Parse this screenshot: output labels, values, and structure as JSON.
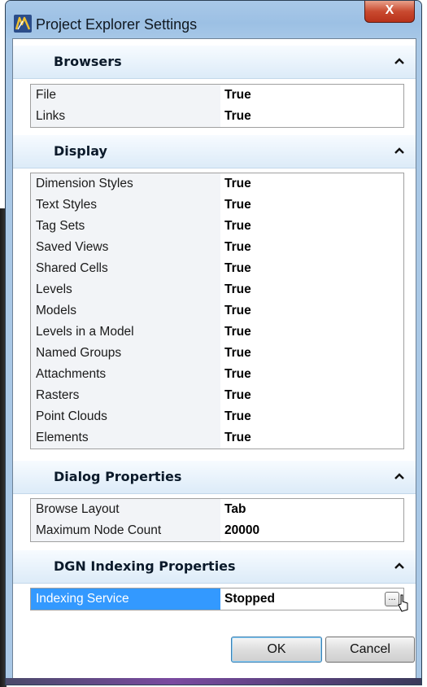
{
  "window": {
    "title": "Project Explorer Settings",
    "close_label": "X"
  },
  "sections": [
    {
      "header": "Browsers",
      "rows": [
        {
          "name": "File",
          "value": "True"
        },
        {
          "name": "Links",
          "value": "True"
        }
      ]
    },
    {
      "header": "Display",
      "rows": [
        {
          "name": "Dimension Styles",
          "value": "True"
        },
        {
          "name": "Text Styles",
          "value": "True"
        },
        {
          "name": "Tag Sets",
          "value": "True"
        },
        {
          "name": "Saved Views",
          "value": "True"
        },
        {
          "name": "Shared Cells",
          "value": "True"
        },
        {
          "name": "Levels",
          "value": "True"
        },
        {
          "name": "Models",
          "value": "True"
        },
        {
          "name": "Levels in a Model",
          "value": "True"
        },
        {
          "name": "Named Groups",
          "value": "True"
        },
        {
          "name": "Attachments",
          "value": "True"
        },
        {
          "name": "Rasters",
          "value": "True"
        },
        {
          "name": "Point Clouds",
          "value": "True"
        },
        {
          "name": "Elements",
          "value": "True"
        }
      ]
    },
    {
      "header": "Dialog Properties",
      "rows": [
        {
          "name": "Browse Layout",
          "value": "Tab"
        },
        {
          "name": "Maximum Node Count",
          "value": "20000"
        }
      ]
    },
    {
      "header": "DGN Indexing Properties",
      "rows": [
        {
          "name": "Indexing Service",
          "value": "Stopped",
          "selected": true,
          "ellipsis": "..."
        }
      ]
    }
  ],
  "buttons": {
    "ok": "OK",
    "cancel": "Cancel"
  },
  "icons": {
    "app": "microstation-icon",
    "collapse": "chevron-up-icon"
  }
}
